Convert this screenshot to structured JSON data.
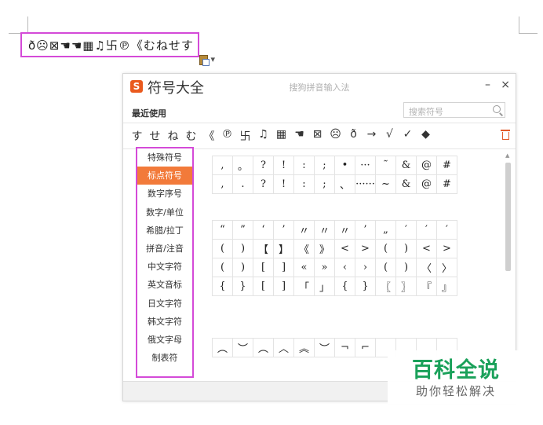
{
  "document": {
    "inserted_text": "ð☹⊠☚☚▦♫卐℗《むねせす"
  },
  "paste_options": {
    "arrow": "▾"
  },
  "dialog": {
    "title": "符号大全",
    "subtitle": "搜狗拼音输入法",
    "logo_char": "S",
    "minimize": "–",
    "close": "×",
    "recent_label": "最近使用",
    "search_placeholder": "搜索符号",
    "recent_symbols": [
      "す",
      "せ",
      "ね",
      "む",
      "《",
      "℗",
      "卐",
      "♫",
      "▦",
      "☚",
      "⊠",
      "☹",
      "ð",
      "→",
      "√",
      "✓",
      "◆"
    ],
    "categories": [
      {
        "label": "特殊符号",
        "active": false
      },
      {
        "label": "标点符号",
        "active": true
      },
      {
        "label": "数字序号",
        "active": false
      },
      {
        "label": "数字/单位",
        "active": false
      },
      {
        "label": "希腊/拉丁",
        "active": false
      },
      {
        "label": "拼音/注音",
        "active": false
      },
      {
        "label": "中文字符",
        "active": false
      },
      {
        "label": "英文音标",
        "active": false
      },
      {
        "label": "日文字符",
        "active": false
      },
      {
        "label": "韩文字符",
        "active": false
      },
      {
        "label": "俄文字母",
        "active": false
      },
      {
        "label": "制表符",
        "active": false
      }
    ],
    "symbol_blocks": [
      {
        "rows": [
          [
            ",",
            "。",
            "?",
            "!",
            ":",
            ";",
            "•",
            "···",
            "˜",
            "&",
            "@",
            "#"
          ],
          [
            ",",
            ".",
            "?",
            "!",
            ":",
            ";",
            "、",
            "······",
            "~",
            "&",
            "@",
            "#"
          ]
        ]
      },
      {
        "rows": [
          [
            "“",
            "”",
            "‘",
            "’",
            "〃",
            "〃",
            "〃",
            "’",
            "„",
            "′",
            "′",
            "′"
          ],
          [
            "(",
            ")",
            "【",
            "】",
            "《",
            "》",
            "<",
            ">",
            "(",
            ")",
            "<",
            ">"
          ],
          [
            "(",
            ")",
            "[",
            "]",
            "«",
            "»",
            "‹",
            "›",
            "(",
            ")",
            "〈",
            "〉"
          ],
          [
            "{",
            "}",
            "[",
            "]",
            "「",
            "」",
            "{",
            "}",
            "〖",
            "〗",
            "『",
            "』"
          ]
        ]
      },
      {
        "rows": [
          [
            "︵",
            "︶",
            "︵",
            "︿",
            "︽",
            "︶",
            "¬",
            "⌐",
            "",
            "",
            "",
            ""
          ]
        ]
      }
    ]
  },
  "watermark": {
    "title": "百科全说",
    "subtitle": "助你轻松解决"
  }
}
